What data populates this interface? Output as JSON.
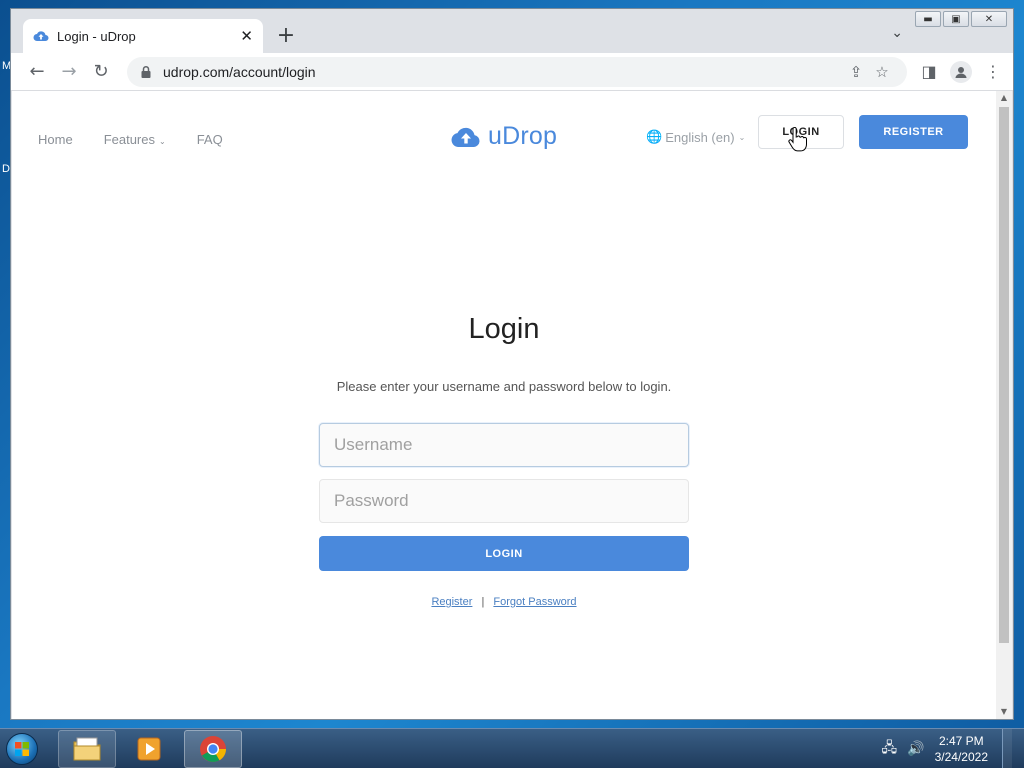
{
  "desktop": {
    "edge_text_top": "M",
    "edge_text_mid": "D"
  },
  "window": {
    "minimize_glyph": "▬",
    "maximize_glyph": "▣",
    "close_glyph": "✕"
  },
  "browser": {
    "tab": {
      "title": "Login - uDrop",
      "close_glyph": "✕"
    },
    "newtab_glyph": "+",
    "tab_search_glyph": "⌄",
    "toolbar": {
      "back_glyph": "←",
      "forward_glyph": "→",
      "reload_glyph": "↻",
      "url": "udrop.com/account/login",
      "share_glyph": "⇪",
      "bookmark_glyph": "☆",
      "sidepanel_glyph": "◨",
      "menu_glyph": "⋮"
    },
    "scrollbar": {
      "up_glyph": "▲",
      "down_glyph": "▼"
    }
  },
  "site": {
    "nav": [
      {
        "label": "Home"
      },
      {
        "label": "Features",
        "caret": "⌄"
      },
      {
        "label": "FAQ"
      }
    ],
    "logo_text": "uDrop",
    "language": {
      "label": "English (en)",
      "caret": "⌄",
      "globe_glyph": "🌐"
    },
    "header_login": "LOGIN",
    "header_register": "REGISTER"
  },
  "login": {
    "title": "Login",
    "subtitle": "Please enter your username and password below to login.",
    "username_placeholder": "Username",
    "password_placeholder": "Password",
    "submit_label": "LOGIN",
    "register_link": "Register",
    "separator": "|",
    "forgot_link": "Forgot Password"
  },
  "taskbar": {
    "tray_network_glyph": "🖧",
    "tray_volume_glyph": "🔊",
    "time": "2:47 PM",
    "date": "3/24/2022"
  },
  "colors": {
    "accent": "#4a89dc",
    "link": "#4a7fc1"
  },
  "icons": {
    "tab_favicon": "cloud-upload-icon",
    "lock": "lock-icon",
    "logo": "cloud-upload-icon",
    "cursor": "hand-pointer-icon",
    "start": "windows-start-icon",
    "explorer": "folder-icon",
    "media": "media-player-icon",
    "chrome": "chrome-icon"
  }
}
